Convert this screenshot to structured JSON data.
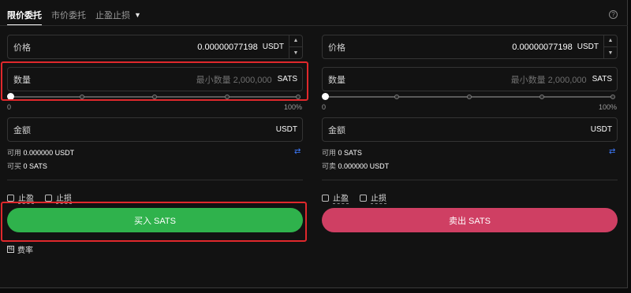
{
  "tabs": [
    {
      "label": "限价委托"
    },
    {
      "label": "市价委托"
    },
    {
      "label": "止盈止损"
    }
  ],
  "help_icon": "question-circle-icon",
  "buy": {
    "price_label": "价格",
    "price_value": "0.00000077198",
    "price_unit": "USDT",
    "qty_label": "数量",
    "qty_placeholder": "最小数量 2,000,000",
    "qty_unit": "SATS",
    "slider_min": "0",
    "slider_max": "100%",
    "slider_value": 0,
    "amount_label": "金额",
    "amount_unit": "USDT",
    "available_label": "可用",
    "available_value": "0.000000 USDT",
    "can_label": "可买",
    "can_value": "0 SATS",
    "tp_label": "止盈",
    "sl_label": "止损",
    "button": "买入 SATS"
  },
  "sell": {
    "price_label": "价格",
    "price_value": "0.00000077198",
    "price_unit": "USDT",
    "qty_label": "数量",
    "qty_placeholder": "最小数量 2,000,000",
    "qty_unit": "SATS",
    "slider_min": "0",
    "slider_max": "100%",
    "slider_value": 0,
    "amount_label": "金额",
    "amount_unit": "USDT",
    "available_label": "可用",
    "available_value": "0 SATS",
    "can_label": "可卖",
    "can_value": "0.000000 USDT",
    "tp_label": "止盈",
    "sl_label": "止损",
    "button": "卖出 SATS"
  },
  "fee_label": "费率",
  "colors": {
    "buy": "#2fb24c",
    "sell": "#cf3f63",
    "accent": "#3d7bff",
    "highlight": "#e0282c"
  }
}
